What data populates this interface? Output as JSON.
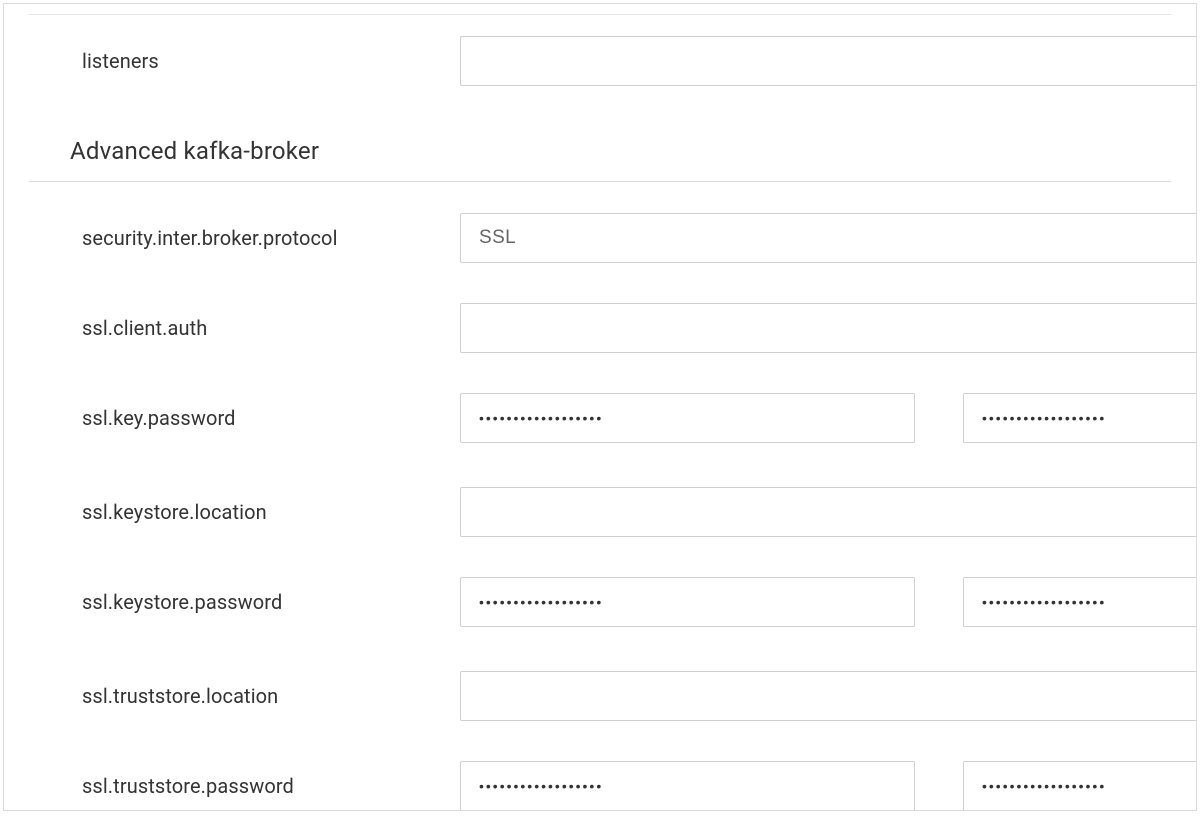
{
  "fields": {
    "listeners": {
      "label": "listeners",
      "value": ""
    },
    "security_inter_broker_protocol": {
      "label": "security.inter.broker.protocol",
      "value": "SSL"
    },
    "ssl_client_auth": {
      "label": "ssl.client.auth",
      "value": ""
    },
    "ssl_key_password": {
      "label": "ssl.key.password",
      "value1": "••••••••••••••••••",
      "value2": "••••••••••••••••••"
    },
    "ssl_keystore_location": {
      "label": "ssl.keystore.location",
      "value": ""
    },
    "ssl_keystore_password": {
      "label": "ssl.keystore.password",
      "value1": "••••••••••••••••••",
      "value2": "••••••••••••••••••"
    },
    "ssl_truststore_location": {
      "label": "ssl.truststore.location",
      "value": ""
    },
    "ssl_truststore_password": {
      "label": "ssl.truststore.password",
      "value1": "••••••••••••••••••",
      "value2": "••••••••••••••••••"
    }
  },
  "section": {
    "advanced_heading": "Advanced kafka-broker"
  }
}
